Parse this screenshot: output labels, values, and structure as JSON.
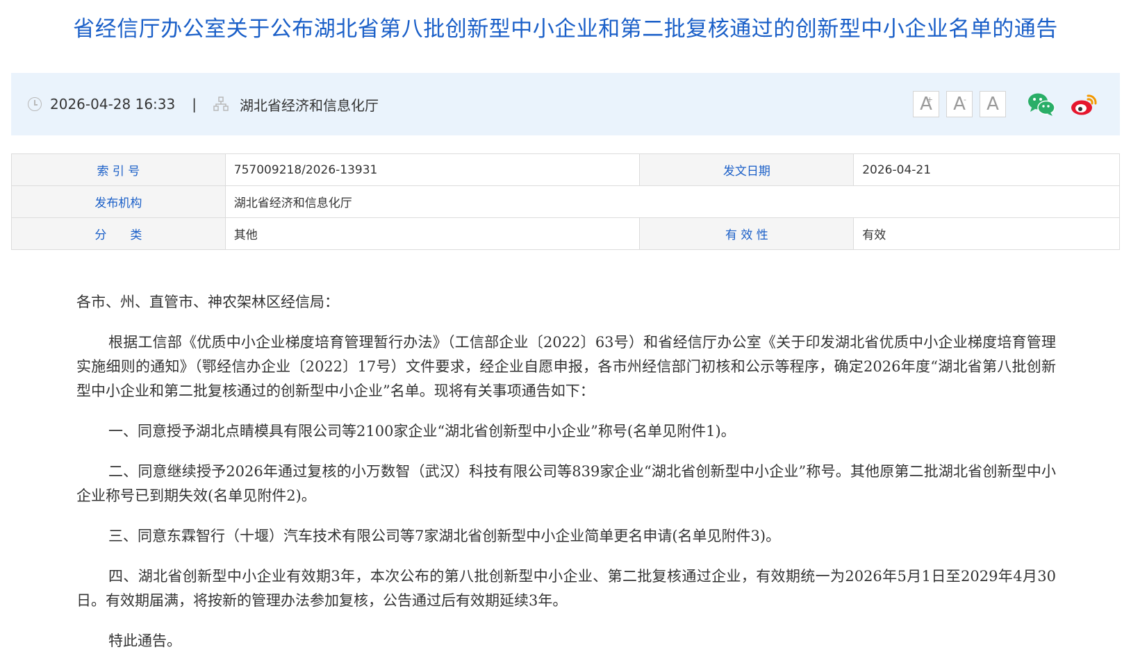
{
  "title": "省经信厅办公室关于公布湖北省第八批创新型中小企业和第二批复核通过的创新型中小企业名单的通告",
  "meta": {
    "datetime": "2026-04-28 16:33",
    "separator": "|",
    "source": "湖北省经济和信息化厅",
    "font_buttons": [
      "A",
      "A",
      "A"
    ],
    "share": {
      "wechat_color": "#2aae67",
      "weibo_color": "#e6162d"
    }
  },
  "info_table": {
    "index_label": "索 引 号",
    "index_value": "757009218/2026-13931",
    "date_label": "发文日期",
    "date_value": "2026-04-21",
    "org_label": "发布机构",
    "org_value": "湖北省经济和信息化厅",
    "category_label": "分　　类",
    "category_value": "其他",
    "validity_label": "有 效 性",
    "validity_value": "有效"
  },
  "body": {
    "salutation": "各市、州、直管市、神农架林区经信局：",
    "p1": "根据工信部《优质中小企业梯度培育管理暂行办法》（工信部企业〔2022〕63号）和省经信厅办公室《关于印发湖北省优质中小企业梯度培育管理实施细则的通知》（鄂经信办企业〔2022〕17号）文件要求，经企业自愿申报，各市州经信部门初核和公示等程序，确定2026年度“湖北省第八批创新型中小企业和第二批复核通过的创新型中小企业”名单。现将有关事项通告如下：",
    "p2": "一、同意授予湖北点睛模具有限公司等2100家企业“湖北省创新型中小企业”称号(名单见附件1)。",
    "p3": "二、同意继续授予2026年通过复核的小万数智（武汉）科技有限公司等839家企业“湖北省创新型中小企业”称号。其他原第二批湖北省创新型中小企业称号已到期失效(名单见附件2)。",
    "p4": "三、同意东霖智行（十堰）汽车技术有限公司等7家湖北省创新型中小企业简单更名申请(名单见附件3)。",
    "p5": "四、湖北省创新型中小企业有效期3年，本次公布的第八批创新型中小企业、第二批复核通过企业，有效期统一为2026年5月1日至2029年4月30日。有效期届满，将按新的管理办法参加复核，公告通过后有效期延续3年。",
    "p6": "特此通告。"
  }
}
